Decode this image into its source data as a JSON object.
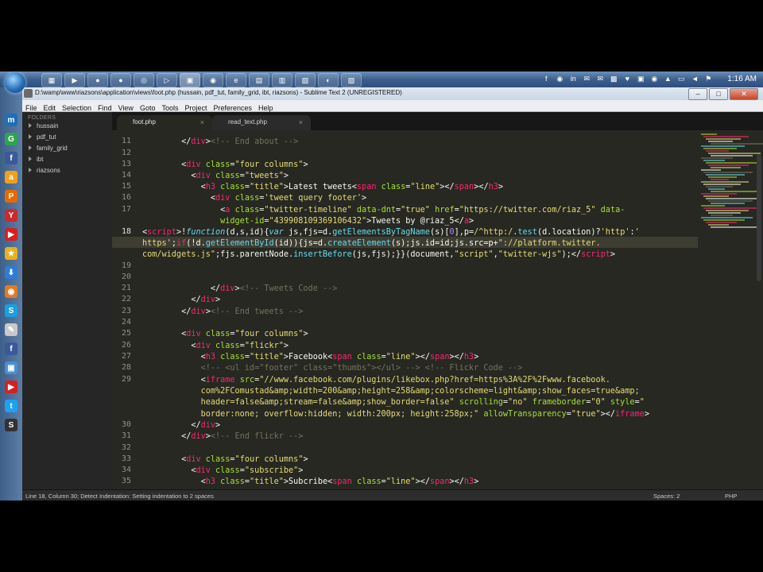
{
  "taskbar": {
    "apps": [
      "▦",
      "▶",
      "●",
      "●",
      "◎",
      "▷",
      "▣",
      "◉",
      "e",
      "▤",
      "▥",
      "▧",
      "◐",
      "▨"
    ],
    "tray_icons": [
      "f",
      "◉",
      "in",
      "✉",
      "✉",
      "▩",
      "♥",
      "▣",
      "◉",
      "▲",
      "▭",
      "◄",
      "⚑"
    ],
    "clock": "1:16 AM"
  },
  "window": {
    "title": "D:\\wamp\\www\\riazsons\\application\\views\\foot.php (hussain, pdf_tut, family_grid, ibt, riazsons) - Sublime Text 2 (UNREGISTERED)",
    "buttons": [
      "–",
      "□",
      "✕"
    ]
  },
  "menu": [
    "File",
    "Edit",
    "Selection",
    "Find",
    "View",
    "Goto",
    "Tools",
    "Project",
    "Preferences",
    "Help"
  ],
  "quicklaunch": [
    {
      "icon": "m",
      "color": "#1f6fb5"
    },
    {
      "icon": "G",
      "color": "#2ea44f"
    },
    {
      "icon": "f",
      "color": "#3b5998"
    },
    {
      "icon": "a",
      "color": "#f0a020"
    },
    {
      "icon": "P",
      "color": "#e66a00"
    },
    {
      "icon": "Y",
      "color": "#cc2a2a"
    },
    {
      "icon": "▶",
      "color": "#d62020"
    },
    {
      "icon": "★",
      "color": "#e8b020"
    },
    {
      "icon": "⬇",
      "color": "#2f7cd6"
    },
    {
      "icon": "◉",
      "color": "#e07b20"
    },
    {
      "icon": "S",
      "color": "#1aa0e0"
    },
    {
      "icon": "✎",
      "color": "#c9c9c9"
    },
    {
      "icon": "f",
      "color": "#3b5998"
    },
    {
      "icon": "▣",
      "color": "#4a8fd0"
    },
    {
      "icon": "▶",
      "color": "#d62020"
    },
    {
      "icon": "t",
      "color": "#1da1f2"
    },
    {
      "icon": "S",
      "color": "#333333"
    }
  ],
  "sidebar": {
    "heading": "FOLDERS",
    "folders": [
      "hussain",
      "pdf_tut",
      "family_grid",
      "ibt",
      "riazsons"
    ]
  },
  "tabs": [
    {
      "label": "foot.php",
      "close": "×",
      "active": true
    },
    {
      "label": "read_text.php",
      "close": "×",
      "active": false
    }
  ],
  "editor": {
    "current_line": 18,
    "gutter": [
      "11",
      "12",
      "13",
      "14",
      "15",
      "16",
      "17",
      "",
      "18",
      "",
      "",
      "19",
      "20",
      "21",
      "22",
      "23",
      "24",
      "25",
      "26",
      "27",
      "28",
      "29",
      "",
      "",
      "",
      "30",
      "31",
      "32",
      "33",
      "34",
      "35"
    ]
  },
  "status": {
    "left": "Line 18, Column 30; Detect Indentation: Setting indentation to 2 spaces",
    "spaces": "Spaces: 2",
    "syntax": "PHP"
  }
}
